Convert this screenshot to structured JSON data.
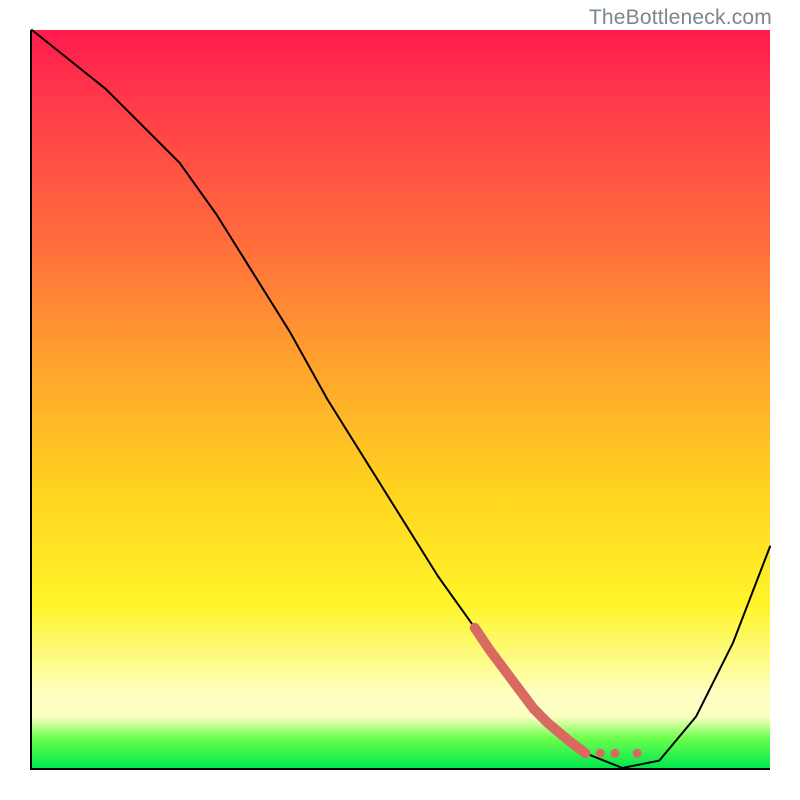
{
  "watermark": "TheBottleneck.com",
  "chart_data": {
    "type": "line",
    "title": "",
    "xlabel": "",
    "ylabel": "",
    "xlim": [
      0,
      100
    ],
    "ylim": [
      0,
      100
    ],
    "grid": false,
    "legend": false,
    "gradient_stops": [
      {
        "pct": 0,
        "color": "#ff1a4d"
      },
      {
        "pct": 10,
        "color": "#ff3b4a"
      },
      {
        "pct": 28,
        "color": "#ff6b3d"
      },
      {
        "pct": 45,
        "color": "#ffa22e"
      },
      {
        "pct": 62,
        "color": "#ffd21f"
      },
      {
        "pct": 78,
        "color": "#fff52a"
      },
      {
        "pct": 90,
        "color": "#fdffc2"
      },
      {
        "pct": 93,
        "color": "#fdffc2"
      },
      {
        "pct": 96,
        "color": "#6bff4d"
      },
      {
        "pct": 100,
        "color": "#00e84d"
      }
    ],
    "series": [
      {
        "name": "bottleneck-curve",
        "color": "#000000",
        "stroke_width": 2,
        "x": [
          0,
          5,
          10,
          15,
          20,
          25,
          30,
          35,
          40,
          45,
          50,
          55,
          60,
          65,
          70,
          75,
          80,
          85,
          90,
          95,
          100
        ],
        "y": [
          100,
          96,
          92,
          87,
          82,
          75,
          67,
          59,
          50,
          42,
          34,
          26,
          19,
          12,
          6,
          2,
          0,
          1,
          7,
          17,
          30
        ]
      },
      {
        "name": "highlight-segment",
        "color": "#d96a62",
        "stroke_width": 10,
        "x": [
          60,
          62,
          65,
          68,
          70,
          73,
          75
        ],
        "y": [
          19,
          16,
          12,
          8,
          6,
          3.5,
          2
        ]
      }
    ],
    "markers": [
      {
        "name": "highlight-dot-1",
        "x": 77,
        "y": 2,
        "r": 4.5,
        "color": "#d96a62"
      },
      {
        "name": "highlight-dot-2",
        "x": 79,
        "y": 2,
        "r": 4.5,
        "color": "#d96a62"
      },
      {
        "name": "highlight-dot-3",
        "x": 82,
        "y": 2,
        "r": 4.5,
        "color": "#d96a62"
      }
    ]
  }
}
